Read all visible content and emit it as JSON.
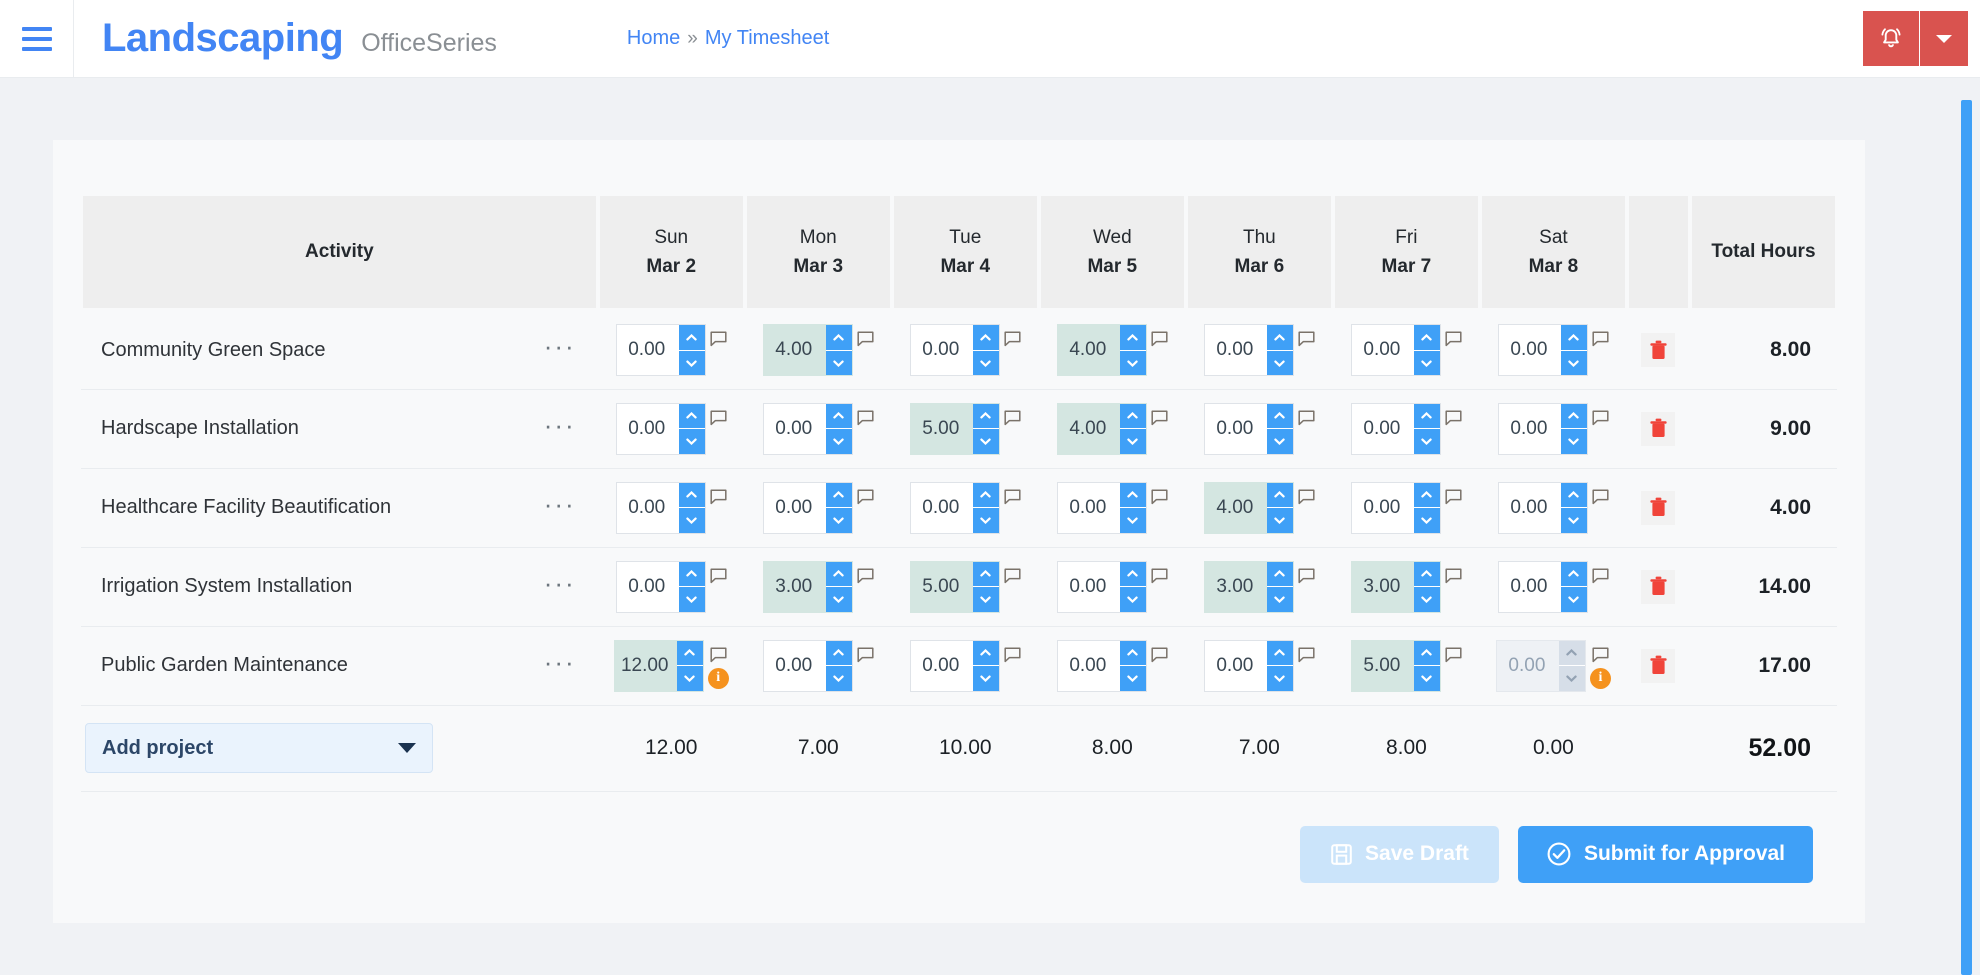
{
  "header": {
    "menu_icon": "hamburger-icon",
    "brand": "Landscaping",
    "brand_suffix": "OfficeSeries",
    "breadcrumb": {
      "home": "Home",
      "separator": "»",
      "current": "My Timesheet"
    },
    "notification_icon": "bell-icon",
    "dropdown_icon": "caret-down-icon",
    "accent_red": "#d9534f",
    "accent_blue": "#4285f4"
  },
  "table": {
    "columns": {
      "activity": "Activity",
      "total_hours": "Total Hours"
    },
    "days": [
      {
        "dow": "Sun",
        "date": "Mar 2"
      },
      {
        "dow": "Mon",
        "date": "Mar 3"
      },
      {
        "dow": "Tue",
        "date": "Mar 4"
      },
      {
        "dow": "Wed",
        "date": "Mar 5"
      },
      {
        "dow": "Thu",
        "date": "Mar 6"
      },
      {
        "dow": "Fri",
        "date": "Mar 7"
      },
      {
        "dow": "Sat",
        "date": "Mar 8"
      }
    ],
    "row_menu_label": "···",
    "rows": [
      {
        "activity": "Community Green Space",
        "values": [
          "0.00",
          "4.00",
          "0.00",
          "4.00",
          "0.00",
          "0.00",
          "0.00"
        ],
        "filled": [
          false,
          true,
          false,
          true,
          false,
          false,
          false
        ],
        "disabled": [
          false,
          false,
          false,
          false,
          false,
          false,
          false
        ],
        "warning": [
          false,
          false,
          false,
          false,
          false,
          false,
          false
        ],
        "total": "8.00"
      },
      {
        "activity": "Hardscape Installation",
        "values": [
          "0.00",
          "0.00",
          "5.00",
          "4.00",
          "0.00",
          "0.00",
          "0.00"
        ],
        "filled": [
          false,
          false,
          true,
          true,
          false,
          false,
          false
        ],
        "disabled": [
          false,
          false,
          false,
          false,
          false,
          false,
          false
        ],
        "warning": [
          false,
          false,
          false,
          false,
          false,
          false,
          false
        ],
        "total": "9.00"
      },
      {
        "activity": "Healthcare Facility Beautification",
        "values": [
          "0.00",
          "0.00",
          "0.00",
          "0.00",
          "4.00",
          "0.00",
          "0.00"
        ],
        "filled": [
          false,
          false,
          false,
          false,
          true,
          false,
          false
        ],
        "disabled": [
          false,
          false,
          false,
          false,
          false,
          false,
          false
        ],
        "warning": [
          false,
          false,
          false,
          false,
          false,
          false,
          false
        ],
        "total": "4.00"
      },
      {
        "activity": "Irrigation System Installation",
        "values": [
          "0.00",
          "3.00",
          "5.00",
          "0.00",
          "3.00",
          "3.00",
          "0.00"
        ],
        "filled": [
          false,
          true,
          true,
          false,
          true,
          true,
          false
        ],
        "disabled": [
          false,
          false,
          false,
          false,
          false,
          false,
          false
        ],
        "warning": [
          false,
          false,
          false,
          false,
          false,
          false,
          false
        ],
        "total": "14.00"
      },
      {
        "activity": "Public Garden Maintenance",
        "values": [
          "12.00",
          "0.00",
          "0.00",
          "0.00",
          "0.00",
          "5.00",
          "0.00"
        ],
        "filled": [
          true,
          false,
          false,
          false,
          false,
          true,
          false
        ],
        "disabled": [
          false,
          false,
          false,
          false,
          false,
          false,
          true
        ],
        "warning": [
          true,
          false,
          false,
          false,
          false,
          false,
          true
        ],
        "total": "17.00"
      }
    ],
    "footer": {
      "add_project_label": "Add project",
      "day_totals": [
        "12.00",
        "7.00",
        "10.00",
        "8.00",
        "7.00",
        "8.00",
        "0.00"
      ],
      "grand_total": "52.00"
    },
    "icons": {
      "comment": "comment-flag-icon",
      "warning": "info-warning-icon",
      "delete": "trash-icon"
    },
    "colors": {
      "filled_cell": "#d4e6e1",
      "spinner_blue": "#3fa0f7",
      "warning_orange": "#f5921e",
      "delete_red": "#f0443a"
    }
  },
  "actions": {
    "save_draft": "Save Draft",
    "save_draft_icon": "save-disk-icon",
    "save_draft_disabled": true,
    "submit": "Submit for Approval",
    "submit_icon": "check-circle-icon"
  }
}
